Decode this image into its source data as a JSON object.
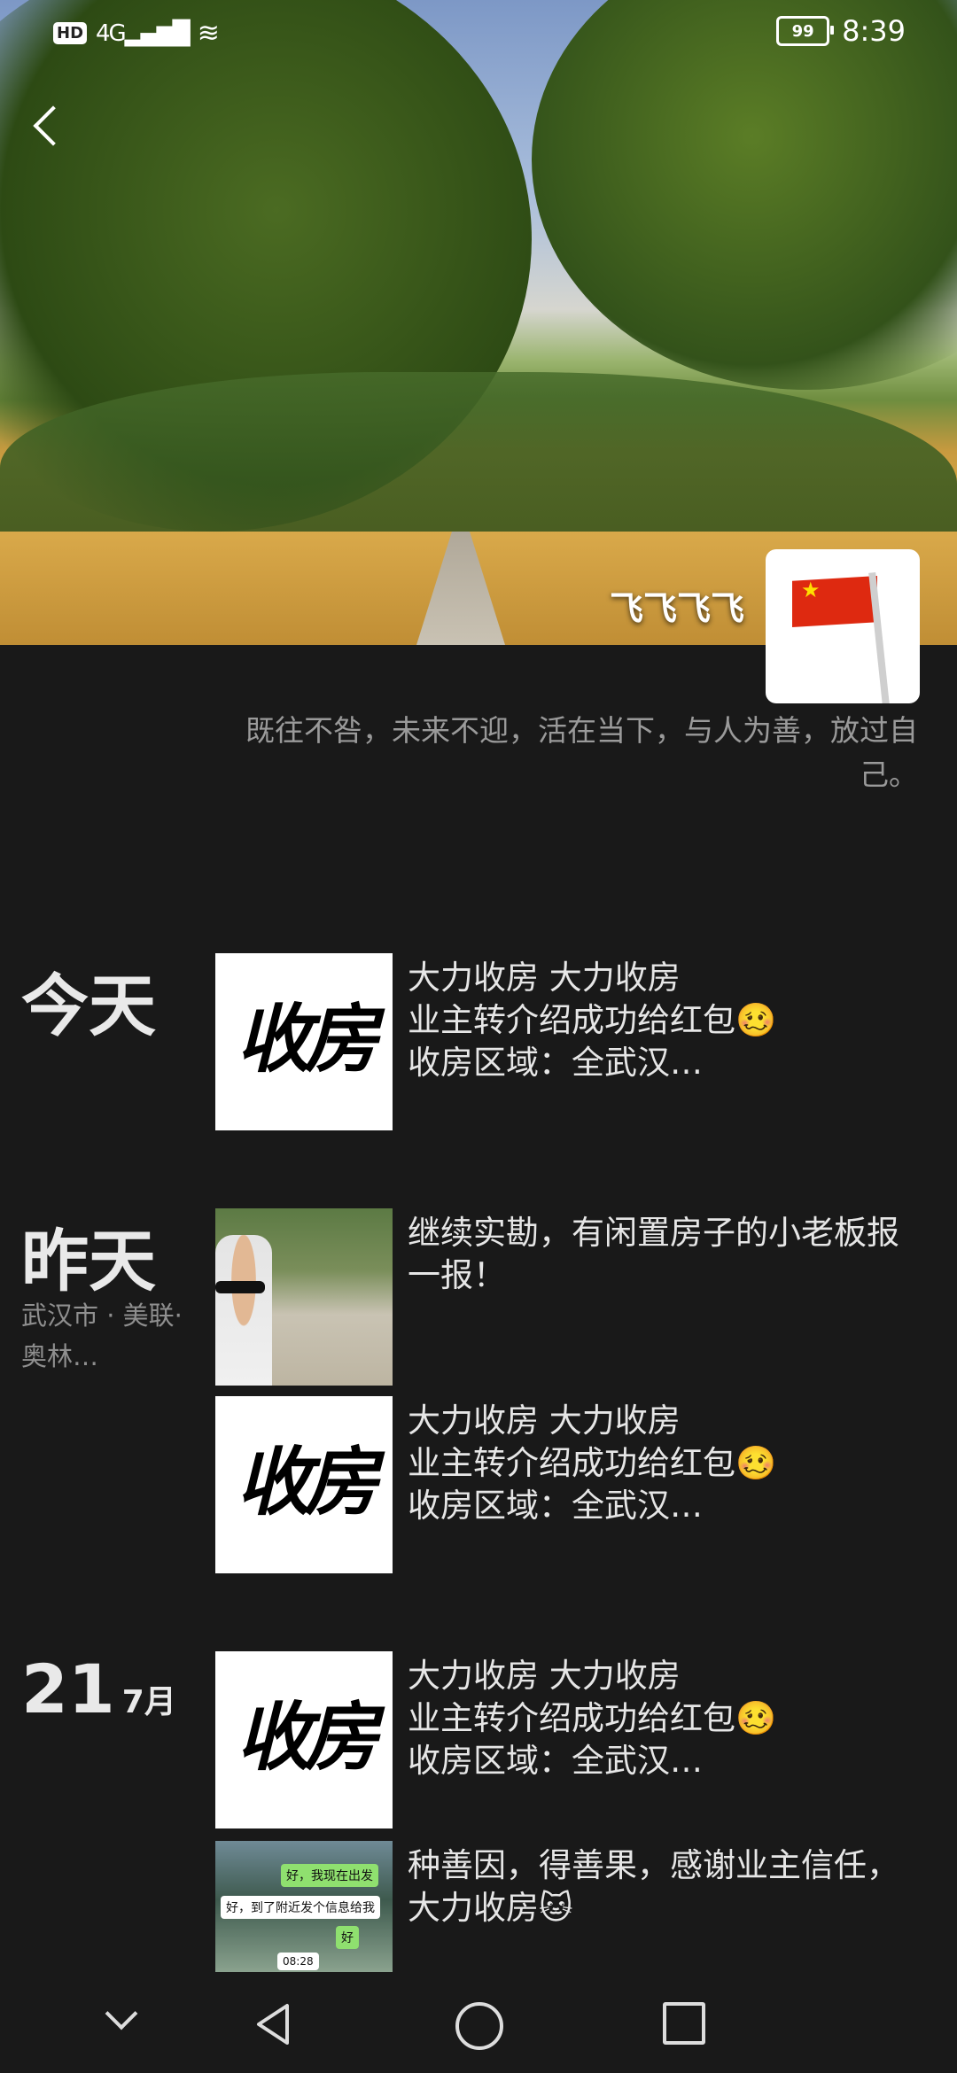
{
  "status_bar": {
    "hd": "HD",
    "network": "4G",
    "battery": "99",
    "time": "8:39"
  },
  "profile": {
    "nickname": "飞飞飞飞",
    "signature": "既往不咎，未来不迎，活在当下，与人为善，放过自己。"
  },
  "groups": [
    {
      "date_big": "今天",
      "date_small": "",
      "location": "",
      "posts": [
        {
          "thumb_text": "收房",
          "text": "大力收房 大力收房\n业主转介绍成功给红包🥴\n收房区域：全武汉…"
        }
      ]
    },
    {
      "date_big": "昨天",
      "date_small": "",
      "location": "武汉市 · 美联·奥林…",
      "posts": [
        {
          "thumb_text": "",
          "text": "继续实勘，有闲置房子的小老板报一报！"
        },
        {
          "thumb_text": "收房",
          "text": "大力收房 大力收房\n业主转介绍成功给红包🥴\n收房区域：全武汉…"
        }
      ]
    },
    {
      "date_big": "21",
      "date_small": "7月",
      "location": "",
      "posts": [
        {
          "thumb_text": "收房",
          "text": "大力收房 大力收房\n业主转介绍成功给红包🥴\n收房区域：全武汉…"
        },
        {
          "thumb_text": "",
          "text": "种善因，得善果，感谢业主信任，大力收房🐱"
        }
      ]
    }
  ],
  "chat_thumb": {
    "bubble1": "好，我现在出发",
    "bubble2": "好，到了附近发个信息给我",
    "bubble3": "好",
    "time": "08:28"
  },
  "icons": {
    "back": "back-arrow-icon",
    "nav_down": "chevron-down-icon",
    "nav_back": "triangle-back-icon",
    "nav_home": "circle-home-icon",
    "nav_recent": "square-recent-icon"
  }
}
